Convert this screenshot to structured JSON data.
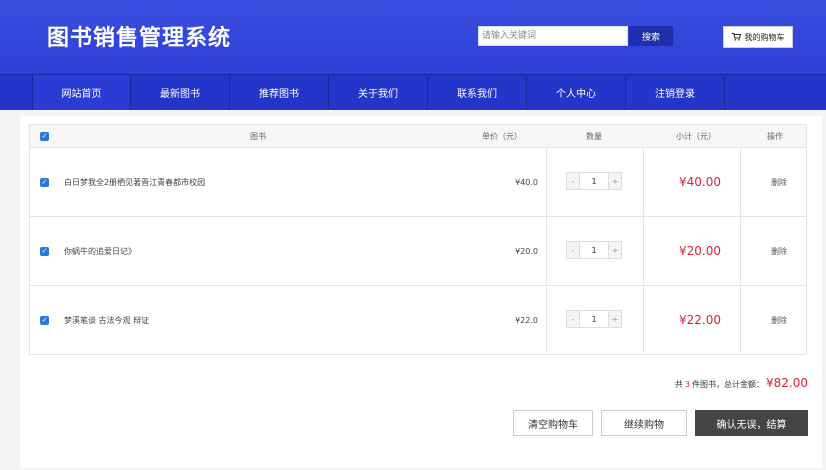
{
  "header": {
    "logo": "图书销售管理系统",
    "search_placeholder": "请输入关键词",
    "search_label": "搜索",
    "cart_label": "我的购物车"
  },
  "nav": [
    "网站首页",
    "最新图书",
    "推荐图书",
    "关于我们",
    "联系我们",
    "个人中心",
    "注销登录"
  ],
  "table": {
    "headers": {
      "book": "图书",
      "price": "单价（元）",
      "qty": "数量",
      "subtotal": "小计（元）",
      "action": "操作"
    },
    "rows": [
      {
        "title": "白日梦我全2册栖见著晋江青春都市校园",
        "price": "¥40.0",
        "qty": "1",
        "subtotal": "¥40.00",
        "action": "删除",
        "minus": "-",
        "plus": "+"
      },
      {
        "title": "你蜗牛的追爱日记》",
        "price": "¥20.0",
        "qty": "1",
        "subtotal": "¥20.00",
        "action": "删除",
        "minus": "-",
        "plus": "+"
      },
      {
        "title": "梦溪笔谈 古法今观 辩证",
        "price": "¥22.0",
        "qty": "1",
        "subtotal": "¥22.00",
        "action": "删除",
        "minus": "-",
        "plus": "+"
      }
    ]
  },
  "summary": {
    "prefix": "共",
    "count": "3",
    "middle": "件图书，总计金额：",
    "total": "¥82.00"
  },
  "buttons": {
    "clear": "清空购物车",
    "continue": "继续购物",
    "checkout": "确认无误，结算"
  },
  "colors": {
    "header": "#3a4fe0",
    "nav": "#2436c9",
    "accent_red": "#d9233a",
    "checkbox": "#2a7bd8"
  }
}
